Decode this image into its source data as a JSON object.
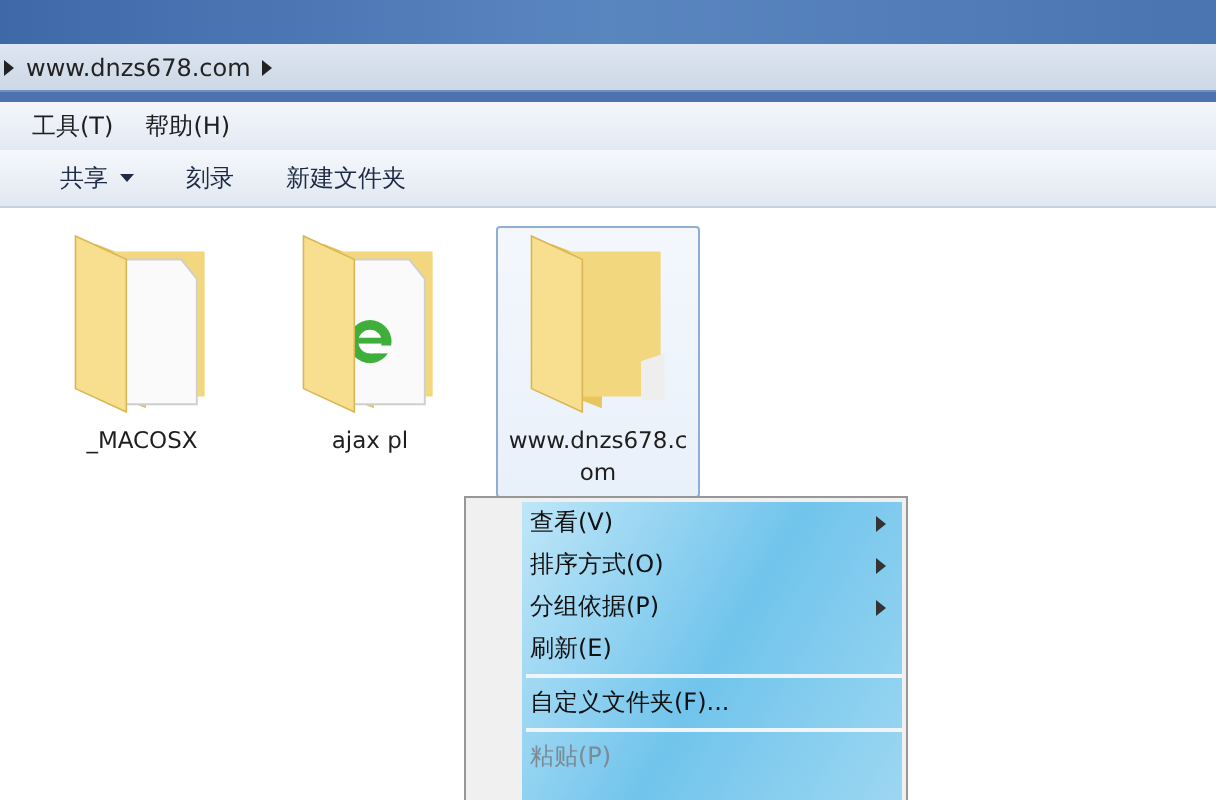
{
  "address_bar": {
    "path": "www.dnzs678.com"
  },
  "menu_bar": [
    "工具(T)",
    "帮助(H)"
  ],
  "toolbar": [
    {
      "label": "共享",
      "dropdown": true
    },
    {
      "label": "刻录",
      "dropdown": false
    },
    {
      "label": "新建文件夹",
      "dropdown": false
    }
  ],
  "files": [
    {
      "name": "_MACOSX",
      "kind": "document",
      "selected": false
    },
    {
      "name": "ajax pl",
      "kind": "browser",
      "selected": false
    },
    {
      "name": "www.dnzs678.com",
      "kind": "empty",
      "selected": true
    }
  ],
  "context_menu": [
    {
      "label": "查看(V)",
      "submenu": true,
      "disabled": false,
      "separator_after": false
    },
    {
      "label": "排序方式(O)",
      "submenu": true,
      "disabled": false,
      "separator_after": false
    },
    {
      "label": "分组依据(P)",
      "submenu": true,
      "disabled": false,
      "separator_after": false
    },
    {
      "label": "刷新(E)",
      "submenu": false,
      "disabled": false,
      "separator_after": true
    },
    {
      "label": "自定义文件夹(F)...",
      "submenu": false,
      "disabled": false,
      "separator_after": true
    },
    {
      "label": "粘贴(P)",
      "submenu": false,
      "disabled": true,
      "separator_after": false
    }
  ]
}
